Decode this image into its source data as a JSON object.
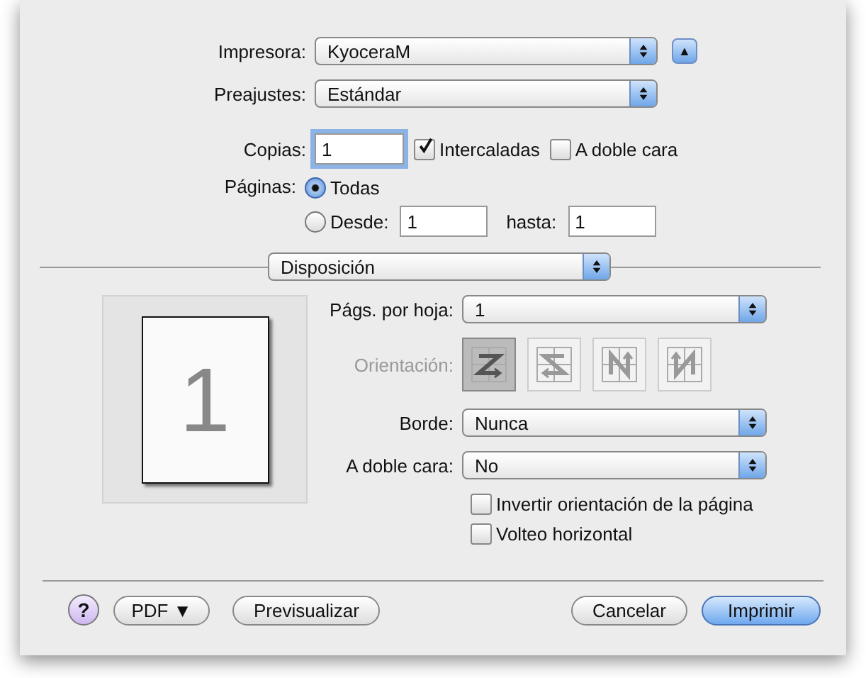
{
  "printer": {
    "label": "Impresora:",
    "value": "KyoceraM",
    "disclosure": "▲"
  },
  "presets": {
    "label": "Preajustes:",
    "value": "Estándar"
  },
  "copies": {
    "label": "Copias:",
    "value": "1",
    "focused": true
  },
  "copy_options": [
    {
      "label": "Intercaladas",
      "checked": true
    },
    {
      "label": "A doble cara",
      "checked": false
    }
  ],
  "pages": {
    "label": "Páginas:",
    "options": [
      {
        "label": "Todas",
        "selected": true
      },
      {
        "label": "Desde:",
        "selected": false
      }
    ],
    "from": "1",
    "to_label": "hasta:",
    "to": "1"
  },
  "section_popup": "Disposición",
  "preview": {
    "page_number": "1"
  },
  "layout": {
    "pages_per_sheet": {
      "label": "Págs. por hoja:",
      "value": "1"
    },
    "orientation": {
      "label": "Orientación:",
      "disabled": true,
      "options": [
        {
          "selected": true
        },
        {
          "selected": false
        },
        {
          "selected": false
        },
        {
          "selected": false
        }
      ]
    },
    "border": {
      "label": "Borde:",
      "value": "Nunca"
    },
    "two_sided": {
      "label": "A doble cara:",
      "value": "No"
    },
    "checkboxes": [
      {
        "label": "Invertir orientación de la página",
        "checked": false
      },
      {
        "label": "Volteo horizontal",
        "checked": false
      }
    ]
  },
  "buttons": [
    {
      "kind": "help",
      "label": "?"
    },
    {
      "kind": "menu",
      "label": "PDF ▼"
    },
    {
      "kind": "normal",
      "label": "Previsualizar"
    },
    {
      "kind": "spacer"
    },
    {
      "kind": "normal",
      "label": "Cancelar"
    },
    {
      "kind": "default",
      "label": "Imprimir"
    }
  ]
}
